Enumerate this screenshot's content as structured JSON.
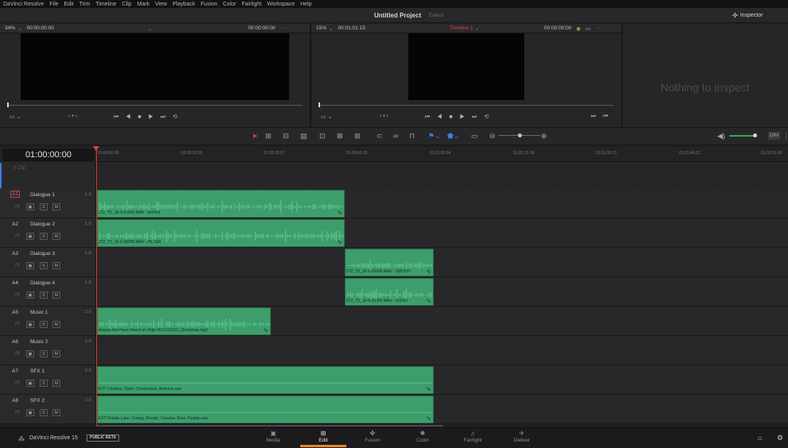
{
  "menu": [
    "DaVinci Resolve",
    "File",
    "Edit",
    "Trim",
    "Timeline",
    "Clip",
    "Mark",
    "View",
    "Playback",
    "Fusion",
    "Color",
    "Fairlight",
    "Workspace",
    "Help"
  ],
  "title": {
    "project": "Untitled Project",
    "status": "Edited",
    "inspector_label": "Inspector"
  },
  "source_viewer": {
    "zoom": "34%",
    "timecode_left": "00:00:00:00",
    "timecode_right": "00:00:00:00"
  },
  "timeline_viewer": {
    "zoom": "15%",
    "duration": "00:01:01:15",
    "timeline_name": "Timeline 1",
    "timecode": "00:00:00:00"
  },
  "inspector": {
    "empty_text": "Nothing to inspect"
  },
  "timecode_display": "01:00:00:00",
  "ruler_ticks": [
    "01:00:00:00",
    "01:00:15:03",
    "01:00:30:07",
    "01:00:45:10",
    "01:01:00:14",
    "01:01:15:18",
    "01:01:30:21",
    "01:01:46:01",
    "01:02:01:05"
  ],
  "video_track": {
    "placeholder": "0 Clip"
  },
  "audio_meter_label": "DIM",
  "tracks": [
    {
      "id": "A1",
      "name": "Dialogue 1",
      "vol": "1.0"
    },
    {
      "id": "A2",
      "name": "Dialogue 2",
      "vol": "1.0"
    },
    {
      "id": "A3",
      "name": "Dialogue 3",
      "vol": "1.0"
    },
    {
      "id": "A4",
      "name": "Dialogue 4",
      "vol": "1.0"
    },
    {
      "id": "A5",
      "name": "Music 1",
      "vol": "2.0"
    },
    {
      "id": "A6",
      "name": "Music 2",
      "vol": "2.0"
    },
    {
      "id": "A7",
      "name": "SFX 1",
      "vol": "2.0"
    },
    {
      "id": "A8",
      "name": "SFX 2",
      "vol": "2.0"
    }
  ],
  "track_buttons": {
    "solo": "S",
    "mute": "M"
  },
  "clips": [
    {
      "track": 0,
      "label": "272_T5_16-9-26005.WAV - BOOM"
    },
    {
      "track": 1,
      "label": "272_T5_16-9-26005.WAV - PETER"
    },
    {
      "track": 2,
      "label": "272_T5_16-9-26005.WAV - SMITHY"
    },
    {
      "track": 3,
      "label": "272_T5_16-9-26005.WAV - BOOM"
    },
    {
      "track": 4,
      "label": "Angels-We-Have-Heard-on-High-HOL010101_Christmas.mp3"
    },
    {
      "track": 6,
      "label": "EXT Crickets, 12am, Connecticut, America.wav"
    },
    {
      "track": 7,
      "label": "EXT Florida Lake, Creepy, People, Cicadas, Boat, People.wav"
    }
  ],
  "footer": {
    "app_name": "DaVinci Resolve 15",
    "badge": "PUBLIC BETA"
  },
  "pages": [
    {
      "label": "Media",
      "icon": "media-icon"
    },
    {
      "label": "Edit",
      "icon": "edit-icon"
    },
    {
      "label": "Fusion",
      "icon": "fusion-icon"
    },
    {
      "label": "Color",
      "icon": "color-icon"
    },
    {
      "label": "Fairlight",
      "icon": "fairlight-icon"
    },
    {
      "label": "Deliver",
      "icon": "deliver-icon"
    }
  ],
  "active_page": "Edit",
  "colors": {
    "clip": "#3d9e6c",
    "playhead": "#d83a30",
    "accent": "#e8862a",
    "timeline_name": "#d84a3a"
  }
}
